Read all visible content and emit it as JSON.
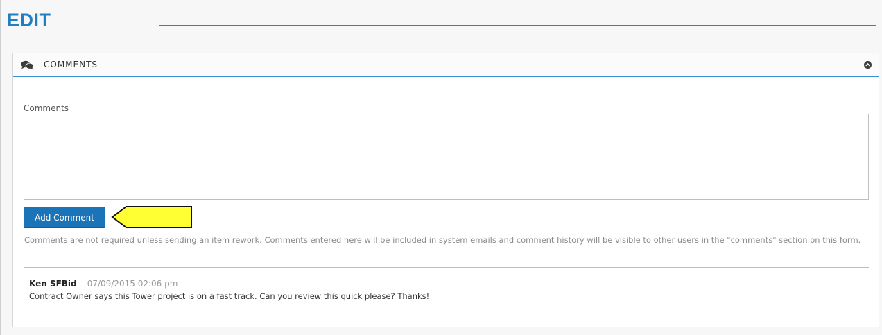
{
  "page": {
    "title": "EDIT"
  },
  "panel": {
    "title": "COMMENTS",
    "icon": "comments-icon",
    "collapse_icon": "chevron-up-circle-icon"
  },
  "form": {
    "comments_label": "Comments",
    "comments_value": "",
    "add_comment_label": "Add Comment",
    "help_text": "Comments are not required unless sending an item rework. Comments entered here will be included in system emails and comment history will be visible to other users in the \"comments\" section on this form."
  },
  "comment_history": [
    {
      "author": "Ken SFBid",
      "date": "07/09/2015 02:06 pm",
      "text": "Contract Owner says this Tower project is on a fast track. Can you review this quick please? Thanks!"
    }
  ],
  "colors": {
    "accent": "#1f7fc2",
    "button": "#1b73b8",
    "highlight_arrow": "#ffff33"
  }
}
